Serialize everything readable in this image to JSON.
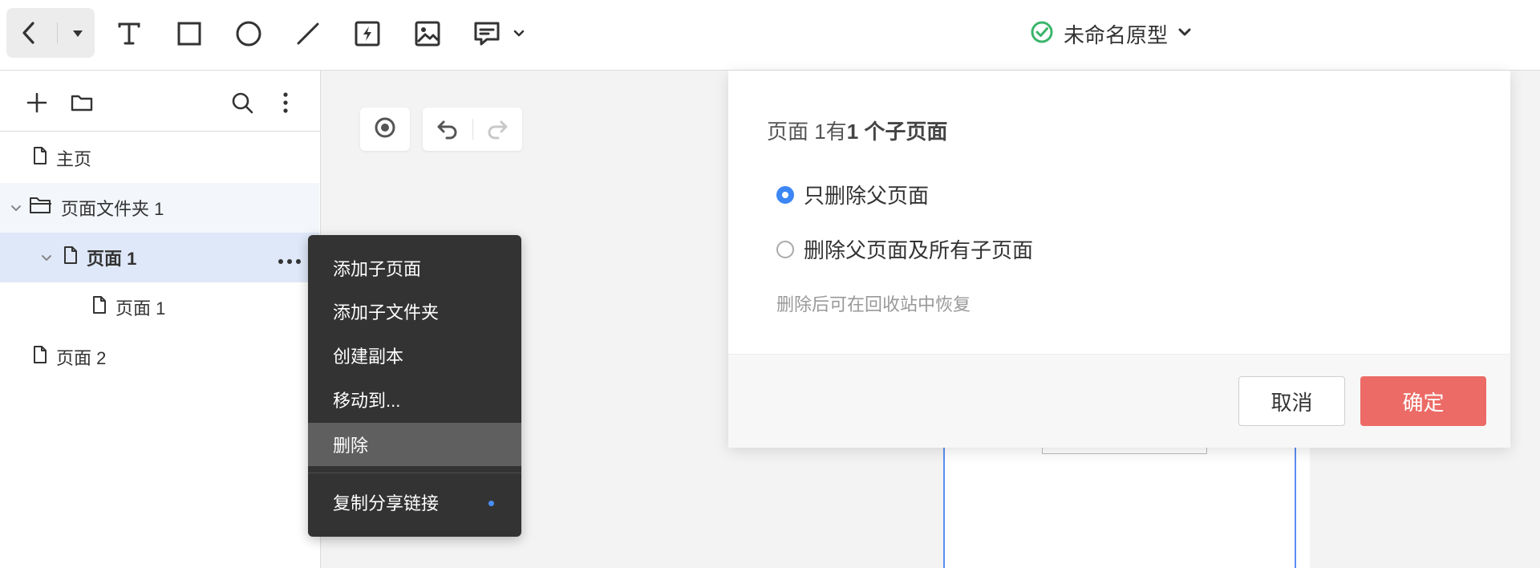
{
  "toolbar": {
    "project_title": "未命名原型"
  },
  "sidebar": {
    "items": [
      {
        "label": "主页"
      },
      {
        "label": "页面文件夹 1"
      },
      {
        "label": "页面 1"
      },
      {
        "label": "页面 1"
      },
      {
        "label": "页面 2"
      }
    ]
  },
  "context_menu": {
    "items": [
      {
        "label": "添加子页面"
      },
      {
        "label": "添加子文件夹"
      },
      {
        "label": "创建副本"
      },
      {
        "label": "移动到..."
      },
      {
        "label": "删除"
      },
      {
        "label": "复制分享链接"
      }
    ]
  },
  "dialog": {
    "message_prefix": "页面 1有",
    "message_bold": "1 个子页面",
    "option_parent_only": "只删除父页面",
    "option_all": "删除父页面及所有子页面",
    "hint": "删除后可在回收站中恢复",
    "cancel_label": "取消",
    "confirm_label": "确定",
    "selected_option": "只删除父页面"
  },
  "colors": {
    "accent": "#3d86f5",
    "danger": "#ec6b66",
    "success": "#3bb56a",
    "menu_bg": "#333333"
  }
}
